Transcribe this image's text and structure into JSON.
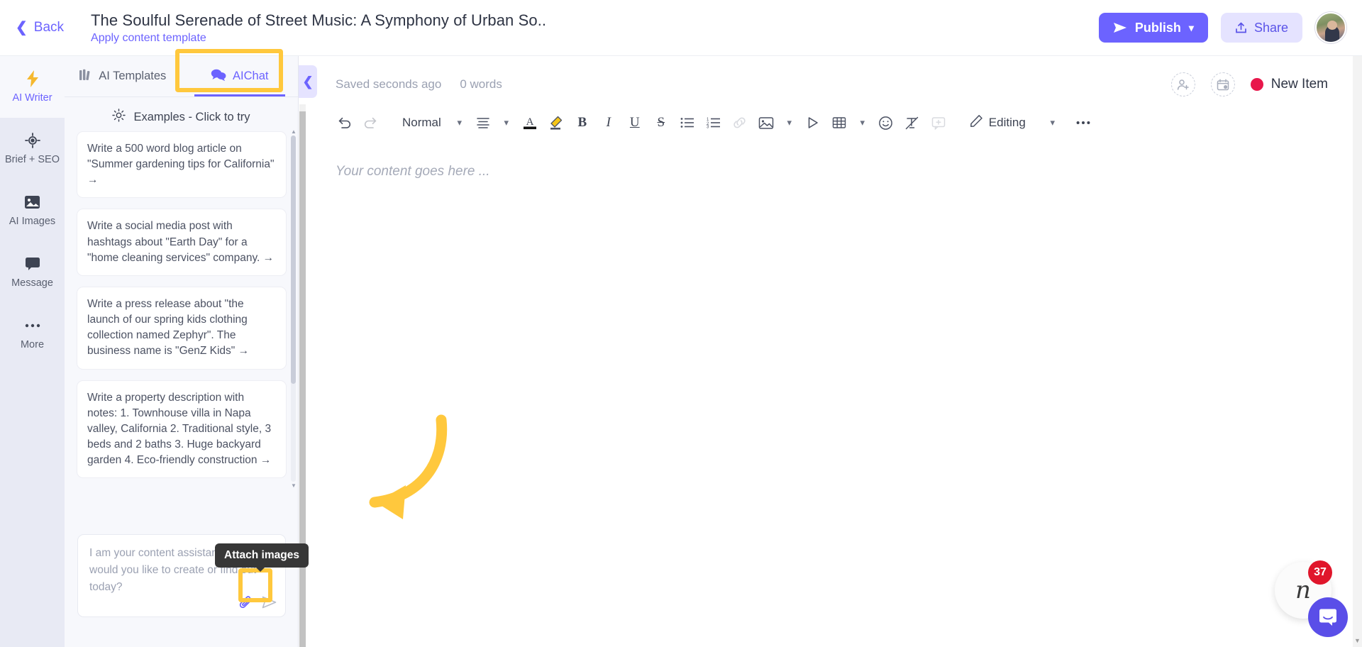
{
  "header": {
    "back_label": "Back",
    "doc_title": "The Soulful Serenade of Street Music: A Symphony of Urban So..",
    "apply_template_label": "Apply content template",
    "publish_label": "Publish",
    "share_label": "Share",
    "avatar_name": "user-avatar",
    "accent_color": "#6c63ff"
  },
  "rail": {
    "items": [
      {
        "label": "AI Writer",
        "icon": "lightning-icon",
        "active": true
      },
      {
        "label": "Brief + SEO",
        "icon": "target-icon",
        "active": false
      },
      {
        "label": "AI Images",
        "icon": "image-icon",
        "active": false
      },
      {
        "label": "Message",
        "icon": "chat-bubble-icon",
        "active": false
      },
      {
        "label": "More",
        "icon": "ellipsis-icon",
        "active": false
      }
    ]
  },
  "chat_panel": {
    "tabs": [
      {
        "label": "AI Templates",
        "icon": "templates-icon",
        "active": false
      },
      {
        "label": "AIChat",
        "icon": "chat-icon",
        "active": true
      }
    ],
    "examples_header": "Examples - Click to try",
    "examples_icon": "sun-icon",
    "cards": [
      {
        "lines": [
          "Write a 500 word blog article on \"Summer",
          "gardening tips for California\""
        ],
        "arrow": "→"
      },
      {
        "lines": [
          "Write a social media post with hashtags",
          "about \"Earth Day\" for a \"home cleaning",
          "services\" company."
        ],
        "arrow": "→"
      },
      {
        "lines": [
          "Write a press release about \"the launch of",
          "our spring kids clothing collection named",
          "Zephyr\".",
          "The business name is \"GenZ Kids\""
        ],
        "arrow": "→"
      },
      {
        "lines": [
          "Write a property description with notes:",
          "1. Townhouse villa in Napa valley,",
          "California",
          "2. Traditional style, 3 beds and 2 baths",
          "3. Huge backyard garden",
          "4. Eco-friendly construction"
        ],
        "arrow": "→"
      }
    ],
    "composer_placeholder": "I am your content assistant. What would you like to create or find out today?",
    "attach_tooltip": "Attach images",
    "attach_icon": "paperclip-icon",
    "send_icon": "send-icon"
  },
  "editor": {
    "collapse_icon": "chevron-left-icon",
    "saved_status": "Saved seconds ago",
    "word_count": "0 words",
    "invite_icon": "add-user-icon",
    "schedule_icon": "calendar-add-icon",
    "new_item_label": "New Item",
    "new_item_dot_color": "#e8174b",
    "toolbar": {
      "undo_icon": "undo-icon",
      "redo_icon": "redo-icon",
      "style_value": "Normal",
      "align_icon": "align-icon",
      "font_color_icon": "font-color-icon",
      "highlight_icon": "highlighter-icon",
      "bold_label": "B",
      "italic_label": "I",
      "underline_label": "U",
      "strike_label": "S",
      "bullet_list_icon": "bullet-list-icon",
      "numbered_list_icon": "numbered-list-icon",
      "link_icon": "link-icon",
      "image_icon": "image-insert-icon",
      "video_icon": "video-icon",
      "table_icon": "table-icon",
      "emoji_icon": "emoji-icon",
      "clear-format_icon": "clear-format-icon",
      "comment_icon": "comment-icon",
      "editing_label": "Editing",
      "editing_icon": "pencil-icon",
      "more_icon": "ellipsis-icon"
    },
    "content_placeholder": "Your content goes here ..."
  },
  "widgets": {
    "helper_glyph": "n",
    "notification_count": "37",
    "intercom_icon": "intercom-chat-icon"
  }
}
